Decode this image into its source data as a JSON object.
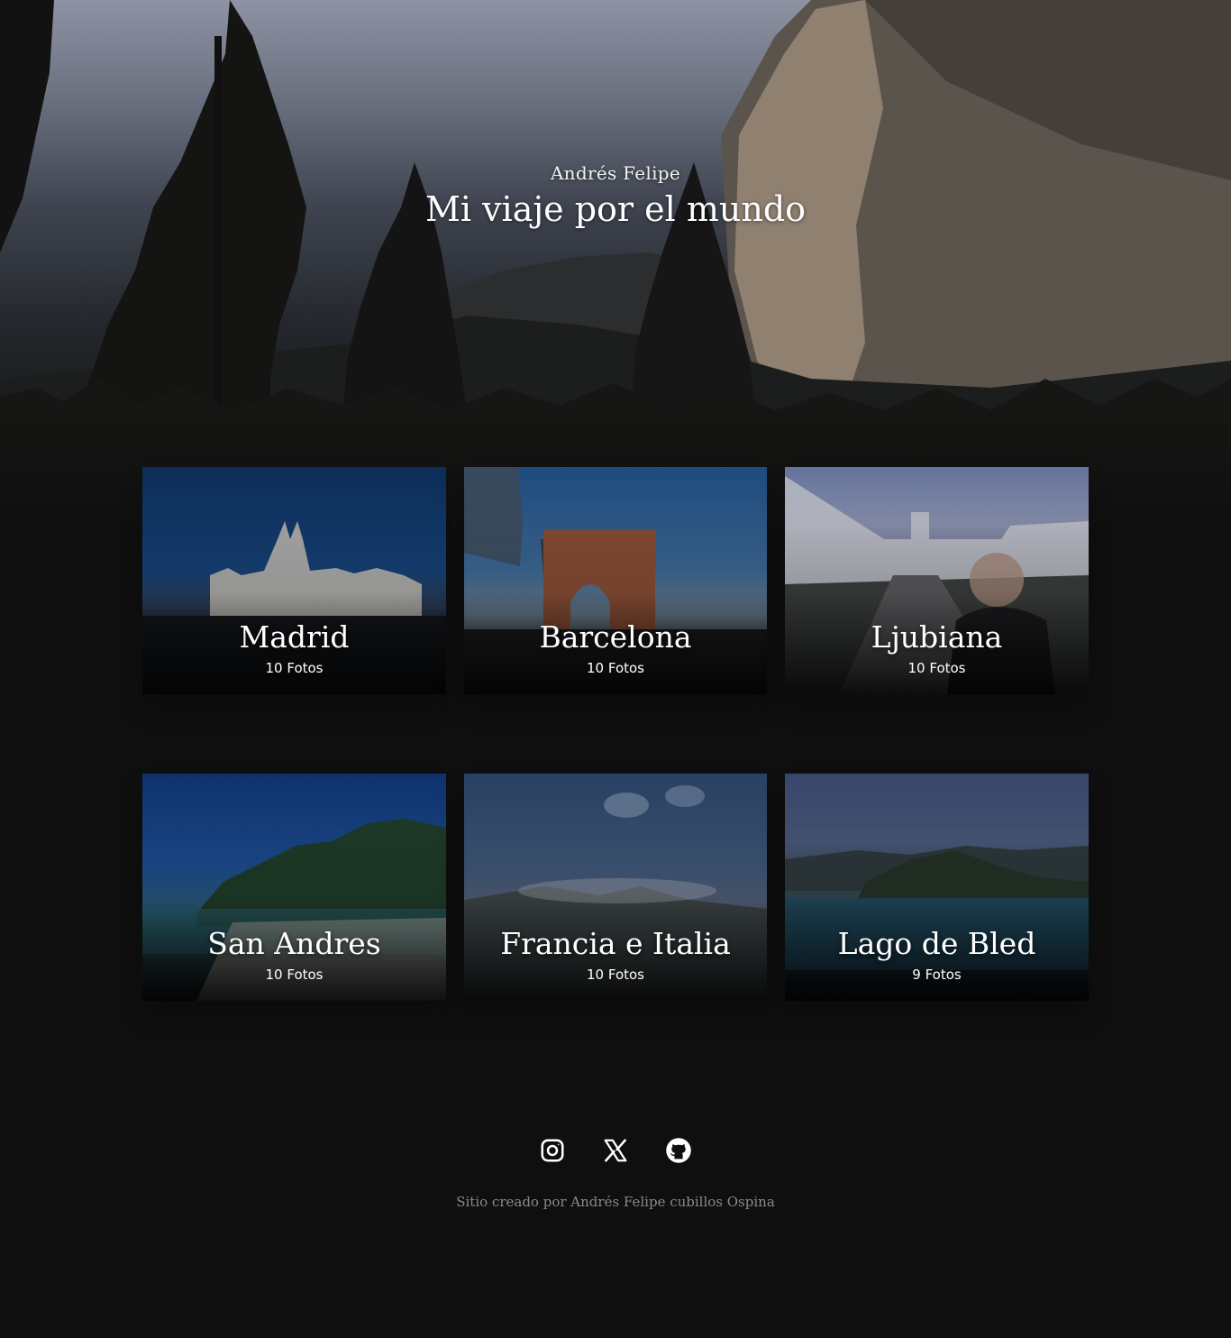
{
  "hero": {
    "author": "Andrés Felipe",
    "title": "Mi viaje por el mundo"
  },
  "gallery": {
    "cards": [
      {
        "city": "Madrid",
        "count": "10 Fotos"
      },
      {
        "city": "Barcelona",
        "count": "10 Fotos"
      },
      {
        "city": "Ljubiana",
        "count": "10 Fotos"
      },
      {
        "city": "San Andres",
        "count": "10 Fotos"
      },
      {
        "city": "Francia e Italia",
        "count": "10 Fotos"
      },
      {
        "city": "Lago de Bled",
        "count": "9 Fotos"
      }
    ]
  },
  "footer": {
    "social": [
      "instagram-icon",
      "x-icon",
      "github-icon"
    ],
    "credit": "Sitio creado por Andrés Felipe cubillos Ospina"
  },
  "colors": {
    "background": "#0f0f0f",
    "text": "#ffffff",
    "muted": "#8a8a8a"
  }
}
